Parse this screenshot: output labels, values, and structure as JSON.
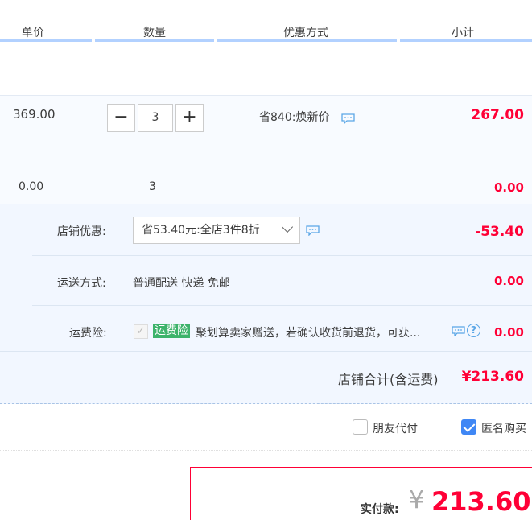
{
  "header": {
    "col_price": "单价",
    "col_qty": "数量",
    "col_promo": "优惠方式",
    "col_subtotal": "小计"
  },
  "item1": {
    "price": "369.00",
    "quantity": "3",
    "minus_label": "−",
    "plus_label": "+",
    "promo": "省840:焕新价",
    "subtotal": "267.00"
  },
  "item2": {
    "price": "0.00",
    "quantity": "3",
    "subtotal": "0.00"
  },
  "shop": {
    "discount_label": "店铺优惠:",
    "discount_selected": "省53.40元:全店3件8折",
    "discount_amount": "-53.40",
    "shipping_label": "运送方式:",
    "shipping_value": "普通配送 快递 免邮",
    "shipping_amount": "0.00",
    "insurance_label": "运费险:",
    "insurance_checkmark": "✓",
    "insurance_tag": "运费险",
    "insurance_text": "聚划算卖家赠送，若确认收货前退货，可获...",
    "insurance_help": "?",
    "insurance_amount": "0.00",
    "total_label": "店铺合计(含运费)",
    "total_value": "¥213.60"
  },
  "options": {
    "friend_pay_label": "朋友代付",
    "friend_pay_checked": false,
    "anonymous_label": "匿名购买",
    "anonymous_checked": true
  },
  "payment": {
    "label": "实付款:",
    "currency": "¥",
    "amount": "213.60"
  },
  "icons": {
    "message": "message-bubble-icon",
    "chevron": "chevron-down-icon",
    "help": "question-circle-icon"
  }
}
